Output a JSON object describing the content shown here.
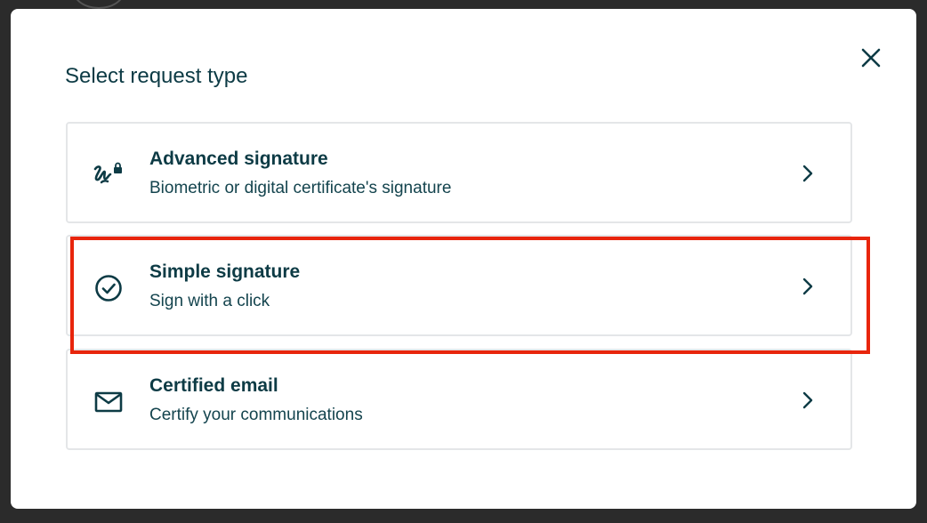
{
  "dialog": {
    "title": "Select request type",
    "close_icon": "close-icon"
  },
  "options": [
    {
      "title": "Advanced signature",
      "description": "Biometric or digital certificate's signature",
      "icon": "signature-lock-icon"
    },
    {
      "title": "Simple signature",
      "description": "Sign with a click",
      "icon": "check-circle-icon"
    },
    {
      "title": "Certified email",
      "description": "Certify your communications",
      "icon": "envelope-icon"
    }
  ],
  "colors": {
    "text_primary": "#0d3b45",
    "border": "#e4e6e8",
    "highlight": "#e8250c",
    "backdrop": "#2b2b2b"
  }
}
